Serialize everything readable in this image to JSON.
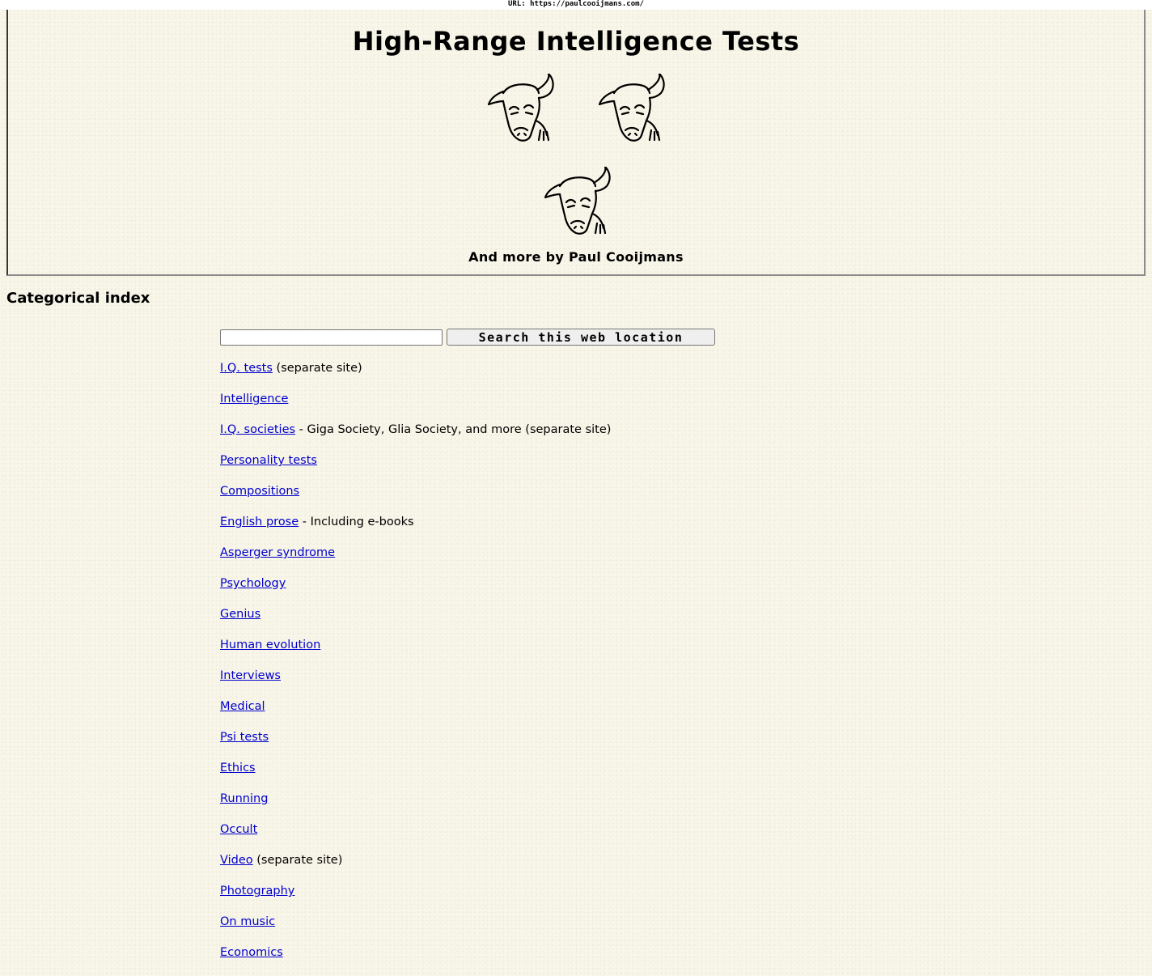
{
  "url_bar": {
    "text": "URL: https://paulcooijmans.com/"
  },
  "banner": {
    "title": "High-Range Intelligence Tests",
    "byline": "And more by Paul Cooijmans",
    "image_icon": "bull-head-icon"
  },
  "index": {
    "title": "Categorical index"
  },
  "search": {
    "input_value": "",
    "button_label": "Search this web location"
  },
  "categories": [
    {
      "label": "I.Q. tests",
      "note": " (separate site)"
    },
    {
      "label": "Intelligence",
      "note": ""
    },
    {
      "label": "I.Q. societies",
      "note": " - Giga Society, Glia Society, and more (separate site)"
    },
    {
      "label": "Personality tests",
      "note": ""
    },
    {
      "label": "Compositions",
      "note": ""
    },
    {
      "label": "English prose",
      "note": " - Including e-books"
    },
    {
      "label": "Asperger syndrome",
      "note": ""
    },
    {
      "label": "Psychology",
      "note": ""
    },
    {
      "label": "Genius",
      "note": ""
    },
    {
      "label": "Human evolution",
      "note": ""
    },
    {
      "label": "Interviews",
      "note": ""
    },
    {
      "label": "Medical",
      "note": ""
    },
    {
      "label": "Psi tests",
      "note": ""
    },
    {
      "label": "Ethics",
      "note": ""
    },
    {
      "label": "Running",
      "note": ""
    },
    {
      "label": "Occult",
      "note": ""
    },
    {
      "label": "Video",
      "note": " (separate site)"
    },
    {
      "label": "Photography",
      "note": ""
    },
    {
      "label": "On music",
      "note": ""
    },
    {
      "label": "Economics",
      "note": ""
    }
  ],
  "colors": {
    "link": "#0000cc",
    "background": "#f8f5e9"
  }
}
